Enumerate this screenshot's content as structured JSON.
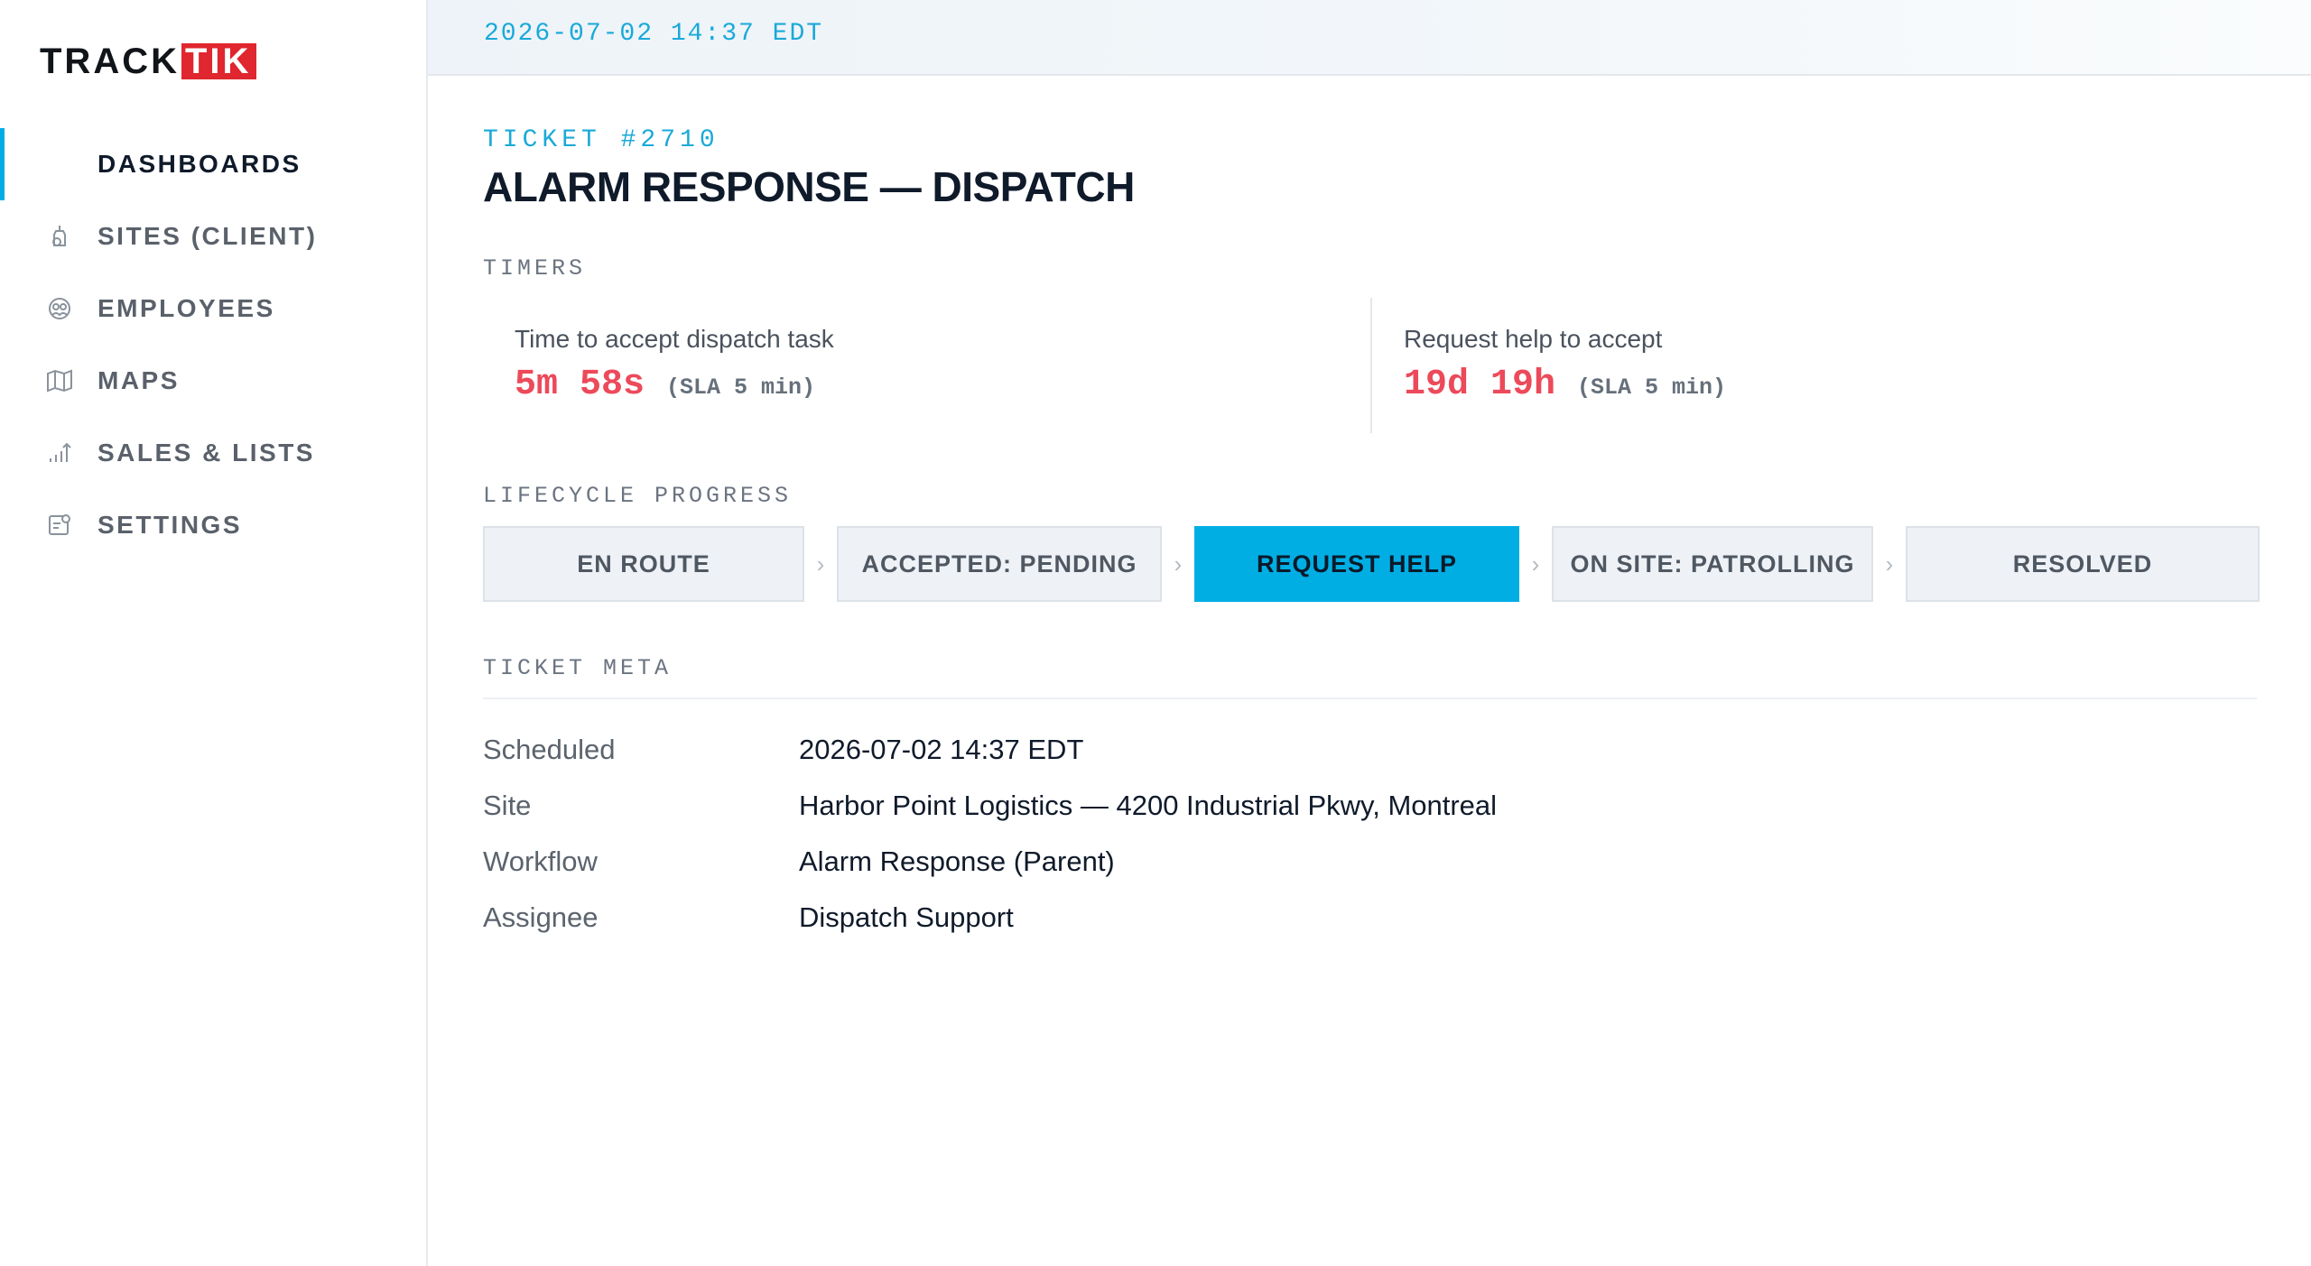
{
  "brand": {
    "part1": "TRACK",
    "part2": "TIK",
    "accent": "#e0262e"
  },
  "sidebar": {
    "items": [
      {
        "label": "DASHBOARDS",
        "icon": "",
        "active": true
      },
      {
        "label": "SITES (CLIENT)",
        "icon": "sites-icon"
      },
      {
        "label": "EMPLOYEES",
        "icon": "employees-icon"
      },
      {
        "label": "MAPS",
        "icon": "map-icon"
      },
      {
        "label": "SALES & LISTS",
        "icon": "chart-icon"
      },
      {
        "label": "SETTINGS",
        "icon": "settings-icon"
      }
    ]
  },
  "topbar": {
    "datetime": "2026-07-02 14:37 EDT"
  },
  "ticket": {
    "id": "TICKET #2710",
    "title": "ALARM RESPONSE — DISPATCH"
  },
  "timers": {
    "label": "TIMERS",
    "items": [
      {
        "label": "Time to accept dispatch task",
        "value": "5m 58s",
        "sla": "(SLA 5 min)"
      },
      {
        "label": "Request help to accept",
        "value": "19d 19h",
        "sla": "(SLA 5 min)"
      }
    ],
    "alert_color": "#ec4a5a"
  },
  "lifecycle": {
    "label": "LIFECYCLE PROGRESS",
    "stages": [
      {
        "label": "EN ROUTE"
      },
      {
        "label": "ACCEPTED: PENDING"
      },
      {
        "label": "REQUEST HELP",
        "active": true
      },
      {
        "label": "ON SITE: PATROLLING"
      },
      {
        "label": "RESOLVED"
      }
    ],
    "active_color": "#00aee4"
  },
  "meta": {
    "label": "TICKET META",
    "rows": [
      {
        "key": "Scheduled",
        "value": "2026-07-02 14:37 EDT"
      },
      {
        "key": "Site",
        "value": "Harbor Point Logistics — 4200 Industrial Pkwy, Montreal"
      },
      {
        "key": "Workflow",
        "value": "Alarm Response (Parent)"
      },
      {
        "key": "Assignee",
        "value": "Dispatch Support"
      }
    ]
  }
}
